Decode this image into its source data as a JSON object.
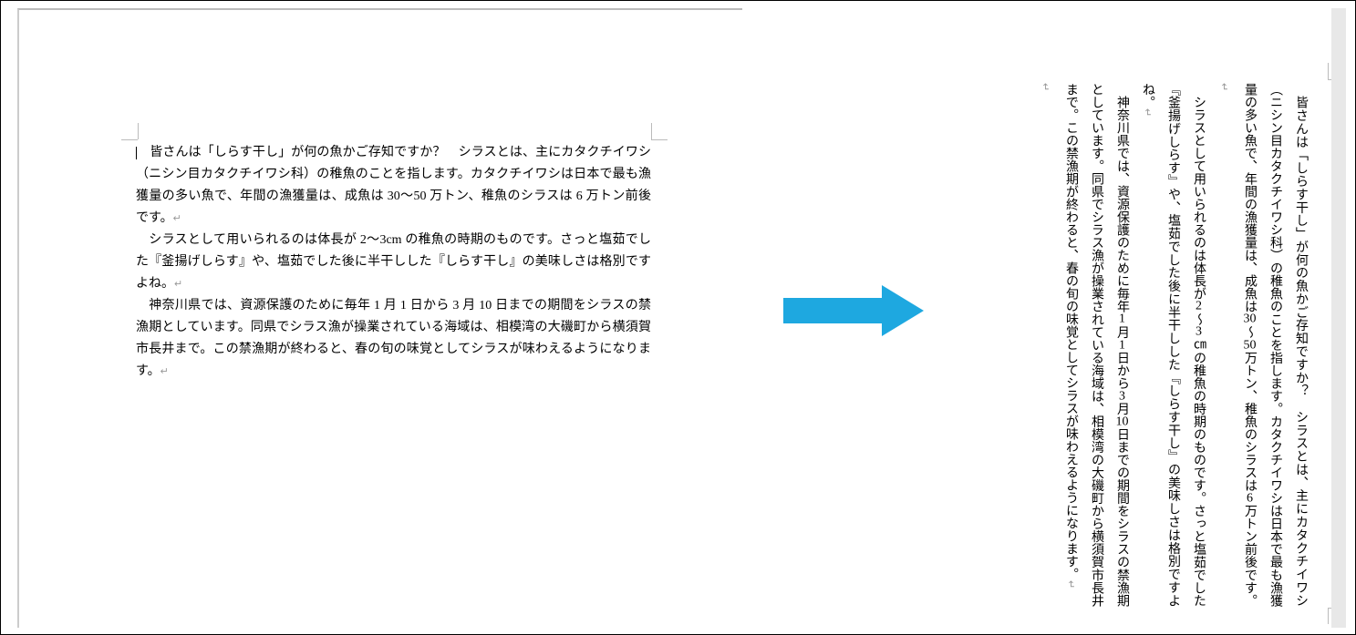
{
  "document": {
    "paragraphs": [
      "皆さんは「しらす干し」が何の魚かご存知ですか？　シラスとは、主にカタクチイワシ（ニシン目カタクチイワシ科）の稚魚のことを指します。カタクチイワシは日本で最も漁獲量の多い魚で、年間の漁獲量は、成魚は 30〜50 万トン、稚魚のシラスは 6 万トン前後です。",
      "シラスとして用いられるのは体長が 2〜3cm の稚魚の時期のものです。さっと塩茹でした『釜揚げしらす』や、塩茹でした後に半干しした『しらす干し』の美味しさは格別ですよね。",
      "神奈川県では、資源保護のために毎年 1 月 1 日から 3 月 10 日までの期間をシラスの禁漁期としています。同県でシラス漁が操業されている海域は、相模湾の大磯町から横須賀市長井まで。この禁漁期が終わると、春の旬の味覚としてシラスが味わえるようになります。"
    ],
    "vertical_paragraphs": [
      {
        "prefix": "　皆さんは「しらす干し」が何の魚かご存知ですか？　シラスとは、主にカタクチイワシ（ニシン目カタクチイワシ科）の稚魚のことを指します。カタクチイワシは日本で最も漁獲量の多い魚で、年間の漁獲量は、成魚は",
        "n1": "30",
        "mid1": "〜",
        "n2": "50",
        "mid2": "万トン、稚魚のシラスは",
        "n3": "6",
        "suffix": "万トン前後です。"
      },
      {
        "prefix": "　シラスとして用いられるのは体長が",
        "n1": "2",
        "mid1": "〜",
        "n2": "3",
        "unit": "㎝",
        "mid2": "の稚魚の時期のものです。さっと塩茹でした『釜揚げしらす』や、塩茹でした後に半干しした『しらす干し』の美味しさは格別ですよね。"
      },
      {
        "prefix": "　神奈川県では、資源保護のために毎年",
        "n1": "1",
        "mid1": "月",
        "n2": "1",
        "mid2": "日から",
        "n3": "3",
        "mid3": "月",
        "n4": "10",
        "suffix": "日までの期間をシラスの禁漁期としています。同県でシラス漁が操業されている海域は、相模湾の大磯町から横須賀市長井まで。この禁漁期が終わると、春の旬の味覚としてシラスが味わえるようになります。"
      }
    ]
  },
  "arrow": {
    "color": "#1EA8E0"
  }
}
